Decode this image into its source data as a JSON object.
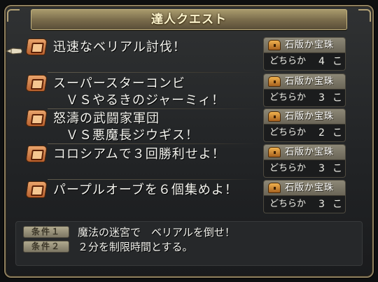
{
  "window": {
    "title": "達人クエスト"
  },
  "quests": [
    {
      "name_line1": "迅速なベリアル討伐！",
      "name_line2": "",
      "reward": "石版か宝珠",
      "count_label": "どちらか",
      "count": "4",
      "unit": "こ",
      "selected": true
    },
    {
      "name_line1": "スーパースターコンビ",
      "name_line2": "ＶＳやるきのジャーミィ！",
      "reward": "石版か宝珠",
      "count_label": "どちらか",
      "count": "3",
      "unit": "こ",
      "selected": false
    },
    {
      "name_line1": "怒濤の武闘家軍団",
      "name_line2": "ＶＳ悪魔長ジウギス！",
      "reward": "石版か宝珠",
      "count_label": "どちらか",
      "count": "2",
      "unit": "こ",
      "selected": false
    },
    {
      "name_line1": "コロシアムで３回勝利せよ！",
      "name_line2": "",
      "reward": "石版か宝珠",
      "count_label": "どちらか",
      "count": "3",
      "unit": "こ",
      "selected": false
    },
    {
      "name_line1": "パープルオーブを６個集めよ！",
      "name_line2": "",
      "reward": "石版か宝珠",
      "count_label": "どちらか",
      "count": "3",
      "unit": "こ",
      "selected": false
    }
  ],
  "conditions": [
    {
      "label": "条件１",
      "text": "魔法の迷宮で　ベリアルを倒せ！"
    },
    {
      "label": "条件２",
      "text": "２分を制限時間とする。"
    }
  ],
  "colors": {
    "title_bar": "#8f8160",
    "reward_header": "#7d7868",
    "panel": "#26282a"
  }
}
